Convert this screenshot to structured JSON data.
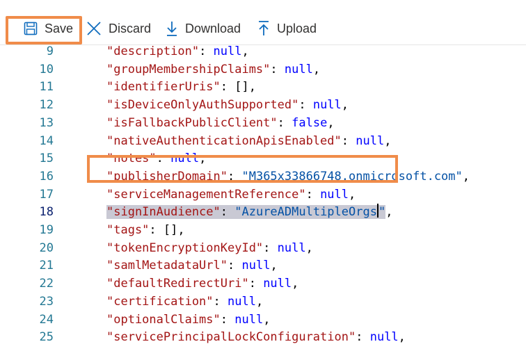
{
  "toolbar": {
    "save_label": "Save",
    "discard_label": "Discard",
    "download_label": "Download",
    "upload_label": "Upload"
  },
  "editor": {
    "lines": [
      {
        "num": "9",
        "key": "\"description\"",
        "value": "null",
        "value_type": "keyword",
        "tail": ","
      },
      {
        "num": "10",
        "key": "\"groupMembershipClaims\"",
        "value": "null",
        "value_type": "keyword",
        "tail": ","
      },
      {
        "num": "11",
        "key": "\"identifierUris\"",
        "value": "[]",
        "value_type": "plain",
        "tail": ","
      },
      {
        "num": "12",
        "key": "\"isDeviceOnlyAuthSupported\"",
        "value": "null",
        "value_type": "keyword",
        "tail": ","
      },
      {
        "num": "13",
        "key": "\"isFallbackPublicClient\"",
        "value": "false",
        "value_type": "keyword",
        "tail": ","
      },
      {
        "num": "14",
        "key": "\"nativeAuthenticationApisEnabled\"",
        "value": "null",
        "value_type": "keyword",
        "tail": ","
      },
      {
        "num": "15",
        "key": "\"notes\"",
        "value": "null",
        "value_type": "keyword",
        "tail": ","
      },
      {
        "num": "16",
        "key": "\"publisherDomain\"",
        "value": "\"M365x33866748.onmicrosoft.com\"",
        "value_type": "string",
        "tail": ","
      },
      {
        "num": "17",
        "key": "\"serviceManagementReference\"",
        "value": "null",
        "value_type": "keyword",
        "tail": ","
      },
      {
        "num": "18",
        "key": "\"signInAudience\"",
        "value": "\"AzureADMultipleOrgs\"",
        "value_type": "string",
        "tail": ",",
        "selected": true
      },
      {
        "num": "19",
        "key": "\"tags\"",
        "value": "[]",
        "value_type": "plain",
        "tail": ","
      },
      {
        "num": "20",
        "key": "\"tokenEncryptionKeyId\"",
        "value": "null",
        "value_type": "keyword",
        "tail": ","
      },
      {
        "num": "21",
        "key": "\"samlMetadataUrl\"",
        "value": "null",
        "value_type": "keyword",
        "tail": ","
      },
      {
        "num": "22",
        "key": "\"defaultRedirectUri\"",
        "value": "null",
        "value_type": "keyword",
        "tail": ","
      },
      {
        "num": "23",
        "key": "\"certification\"",
        "value": "null",
        "value_type": "keyword",
        "tail": ","
      },
      {
        "num": "24",
        "key": "\"optionalClaims\"",
        "value": "null",
        "value_type": "keyword",
        "tail": ","
      },
      {
        "num": "25",
        "key": "\"servicePrincipalLockConfiguration\"",
        "value": "null",
        "value_type": "keyword",
        "tail": ","
      }
    ]
  },
  "colors": {
    "highlight_border": "#f08c4a",
    "key_color": "#a31515",
    "keyword_color": "#0451a5",
    "line_number_color": "#237893",
    "selection": "#c9c9d4"
  }
}
